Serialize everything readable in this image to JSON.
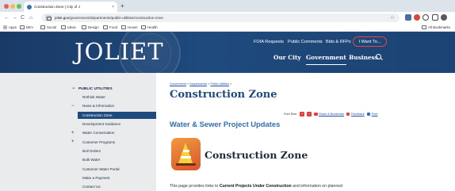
{
  "browser": {
    "tab_title": "Construction Zone | City of J",
    "tab_close": "×",
    "new_tab": "+",
    "nav": {
      "back": "←",
      "forward": "→",
      "reload": "C",
      "home": "⌂"
    },
    "url_host": "joliet.gov",
    "url_path": "/government/departments/public-utilities/construction-zone",
    "star": "☆",
    "bookmarks": [
      "Apps",
      "DEV",
      "Social",
      "Ideas",
      "Design",
      "Food",
      "House",
      "Health"
    ],
    "bookmarks_right": "All Bookmarks",
    "colors": {
      "close": "#ec5e57",
      "minimize": "#f3bd4f",
      "maximize": "#5fc454"
    }
  },
  "header": {
    "logo": "JOLIET",
    "top_links": [
      "FOIA Requests",
      "Public Comments",
      "Bids & RFPs"
    ],
    "cta": "I Want To...",
    "main_links": [
      "Our City",
      "Government",
      "Business"
    ],
    "active_main": "Government"
  },
  "sidebar": {
    "heading": "PUBLIC UTILITIES",
    "heading_sign": "−",
    "items": [
      {
        "label": "Rethink Water",
        "sign": ""
      },
      {
        "label": "News & Information",
        "sign": "−"
      },
      {
        "label": "Construction Zone",
        "sign": "",
        "active": true
      },
      {
        "label": "Development Guidance",
        "sign": ""
      },
      {
        "label": "Water Conservation",
        "sign": "+"
      },
      {
        "label": "Customer Programs",
        "sign": "+"
      },
      {
        "label": "Boil Orders",
        "sign": ""
      },
      {
        "label": "Bulk Water",
        "sign": ""
      },
      {
        "label": "Customer Water Portal",
        "sign": ""
      },
      {
        "label": "Make a Payment",
        "sign": ""
      },
      {
        "label": "Contact Us",
        "sign": ""
      }
    ]
  },
  "main": {
    "breadcrumb": [
      "Government",
      "Departments",
      "Public Utilities"
    ],
    "breadcrumb_sep": " > ",
    "title": "Construction Zone",
    "font_size_label": "Font Size:",
    "font_plus": "+",
    "font_minus": "−",
    "share": "Share & Bookmark",
    "feedback": "Feedback",
    "print": "Print",
    "subtitle": "Water & Sewer Project Updates",
    "icon_heading": "Construction Zone",
    "intro_pre": "This page provides links to ",
    "intro_bold": "Current Projects Under Construction",
    "intro_post": " and information on planned"
  }
}
